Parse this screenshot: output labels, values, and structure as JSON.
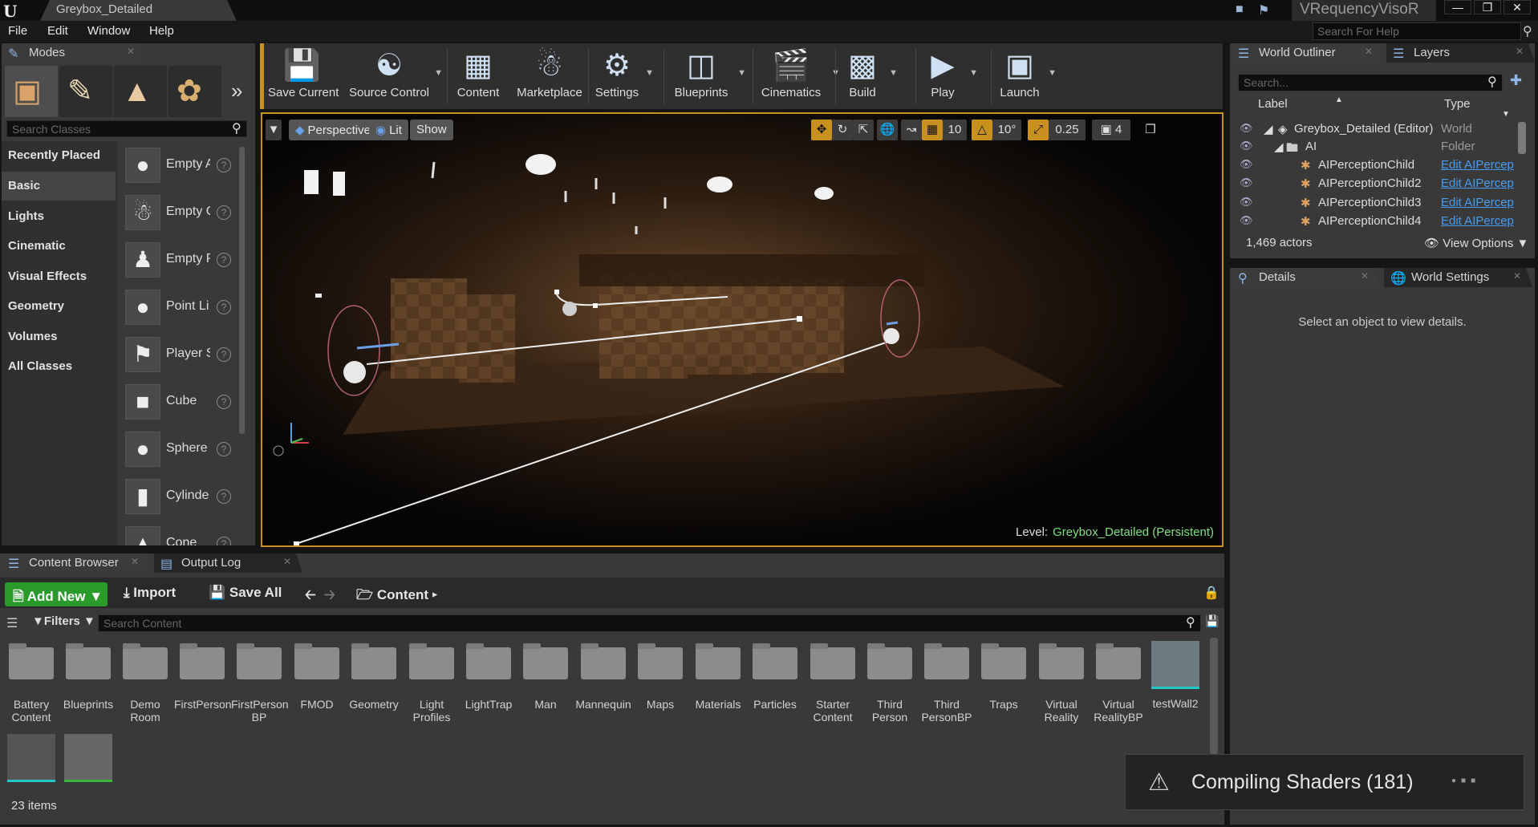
{
  "window": {
    "document_tab": "Greybox_Detailed",
    "app_name": "VRequencyVisoR",
    "help_search_placeholder": "Search For Help"
  },
  "menu": [
    "File",
    "Edit",
    "Window",
    "Help"
  ],
  "modes": {
    "tab_label": "Modes",
    "search_placeholder": "Search Classes",
    "categories": [
      "Recently Placed",
      "Basic",
      "Lights",
      "Cinematic",
      "Visual Effects",
      "Geometry",
      "Volumes",
      "All Classes"
    ],
    "active_category": "Basic",
    "items": [
      "Empty A",
      "Empty C",
      "Empty P",
      "Point Li",
      "Player S",
      "Cube",
      "Sphere",
      "Cylinde",
      "Cone"
    ]
  },
  "toolbar": {
    "buttons": [
      "Save Current",
      "Source Control",
      "Content",
      "Marketplace",
      "Settings",
      "Blueprints",
      "Cinematics",
      "Build",
      "Play",
      "Launch"
    ]
  },
  "viewport": {
    "perspective": "Perspective",
    "lit": "Lit",
    "show": "Show",
    "grid_snap": "10",
    "rot_snap": "10°",
    "scale_snap": "0.25",
    "cam_speed": "4",
    "level_prefix": "Level:",
    "level_name": "Greybox_Detailed (Persistent)"
  },
  "outliner": {
    "tab_label": "World Outliner",
    "layers_tab": "Layers",
    "search_placeholder": "Search...",
    "col_label": "Label",
    "col_type": "Type",
    "rows": [
      {
        "name": "Greybox_Detailed (Editor)",
        "type": "World"
      },
      {
        "name": "AI",
        "type": "Folder"
      },
      {
        "name": "AIPerceptionChild",
        "type": "Edit AIPercep"
      },
      {
        "name": "AIPerceptionChild2",
        "type": "Edit AIPercep"
      },
      {
        "name": "AIPerceptionChild3",
        "type": "Edit AIPercep"
      },
      {
        "name": "AIPerceptionChild4",
        "type": "Edit AIPercep"
      }
    ],
    "actors": "1,469 actors",
    "view_options": "View Options"
  },
  "details": {
    "tab_label": "Details",
    "world_settings_tab": "World Settings",
    "empty_text": "Select an object to view details."
  },
  "content_browser": {
    "tab_label": "Content Browser",
    "output_log_tab": "Output Log",
    "add_new": "Add New",
    "import": "Import",
    "save_all": "Save All",
    "path": "Content",
    "filters": "Filters",
    "search_placeholder": "Search Content",
    "folders": [
      "Battery Content",
      "Blueprints",
      "Demo Room",
      "FirstPerson",
      "FirstPerson BP",
      "FMOD",
      "Geometry",
      "Light Profiles",
      "LightTrap",
      "Man",
      "Mannequin",
      "Maps",
      "Materials",
      "Particles",
      "Starter Content",
      "Third Person",
      "Third PersonBP",
      "Traps",
      "Virtual Reality",
      "Virtual RealityBP",
      "testWall2"
    ],
    "items_count": "23 items"
  },
  "notification": {
    "text": "Compiling Shaders (181)"
  }
}
